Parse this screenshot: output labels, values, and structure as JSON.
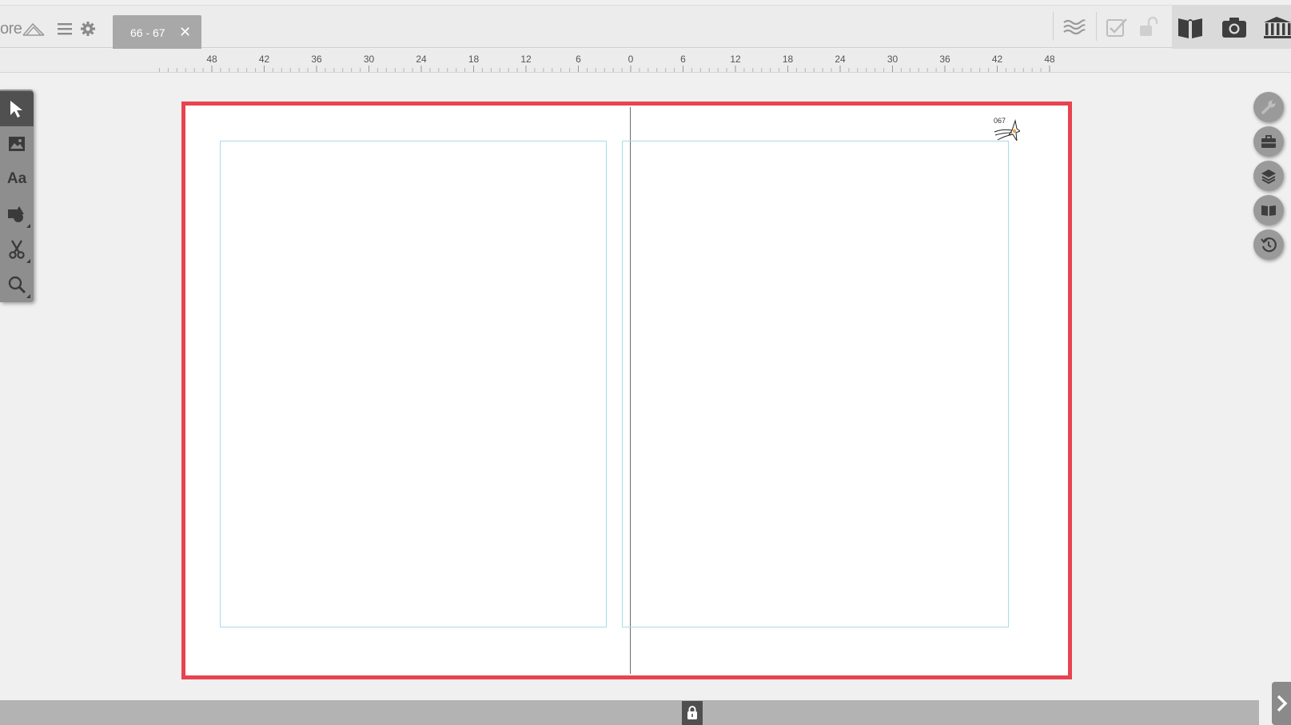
{
  "app": {
    "logo_text": "ore",
    "menu_icon": "hamburger-menu-icon",
    "settings_icon": "gear-icon"
  },
  "tab": {
    "label": "66 - 67",
    "close_glyph": "✕"
  },
  "toolbar_right": {
    "icons": [
      "wave-lines-icon",
      "checklist-icon",
      "unlock-icon",
      "book-open-icon",
      "camera-icon",
      "library-icon"
    ]
  },
  "ruler": {
    "labels": [
      "48",
      "42",
      "36",
      "30",
      "24",
      "18",
      "12",
      "6",
      "0",
      "6",
      "12",
      "18",
      "24",
      "30",
      "36",
      "42",
      "48"
    ]
  },
  "spread": {
    "page_number": "067",
    "border_color": "#e8434f",
    "margin_color": "#a9dce8"
  },
  "left_toolbar": {
    "tools": [
      "select-arrow-icon",
      "image-icon",
      "text-icon",
      "shapes-icon",
      "scissors-icon",
      "zoom-icon"
    ],
    "text_tool_label": "Aa"
  },
  "right_panel": {
    "buttons": [
      "wrench-icon",
      "briefcase-icon",
      "layers-icon",
      "book-icon",
      "history-icon"
    ]
  },
  "bottom": {
    "lock_icon": "lock-icon",
    "next_icon": "chevron-right-icon"
  }
}
